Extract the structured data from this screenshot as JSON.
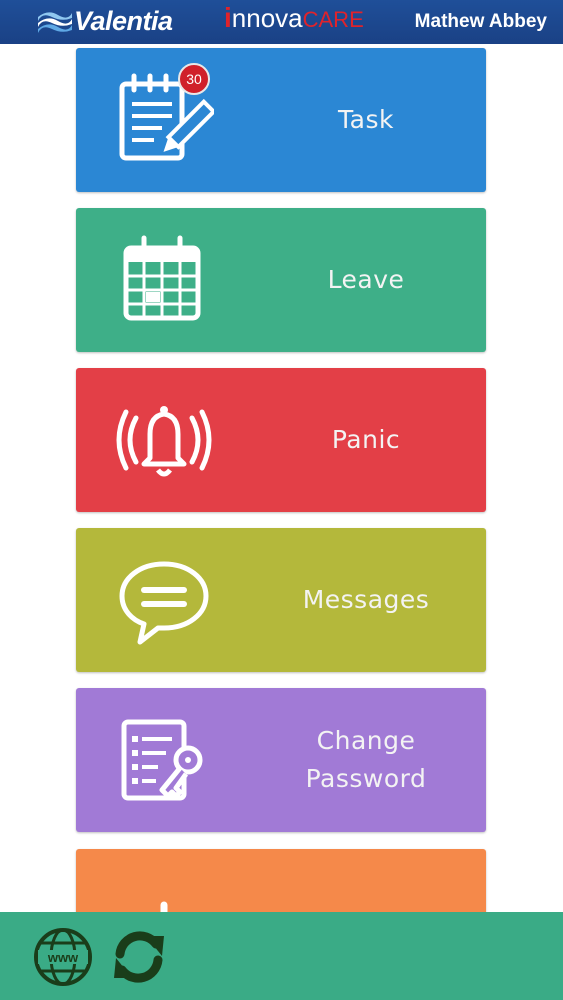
{
  "header": {
    "brand_left": "Valentia",
    "brand_center_i": "i",
    "brand_center_main": "nnova",
    "brand_center_care": "CARE",
    "user_name": "Mathew Abbey"
  },
  "tiles": [
    {
      "label": "Task",
      "color": "#2b87d4",
      "icon": "task-notepad-icon",
      "badge": "30"
    },
    {
      "label": "Leave",
      "color": "#3eaf88",
      "icon": "calendar-icon"
    },
    {
      "label": "Panic",
      "color": "#e33f47",
      "icon": "bell-alarm-icon"
    },
    {
      "label": "Messages",
      "color": "#b4b83b",
      "icon": "chat-bubble-icon"
    },
    {
      "label_line1": "Change",
      "label_line2": "Password",
      "color": "#a17ad6",
      "icon": "password-key-icon"
    },
    {
      "label": "",
      "color": "#f5894a",
      "icon": "power-icon"
    }
  ],
  "footer": {
    "left_icon": "globe-www-icon",
    "right_icon": "refresh-icon",
    "color": "#3aab86"
  }
}
